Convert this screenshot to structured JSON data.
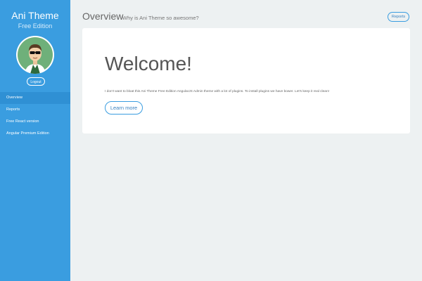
{
  "sidebar": {
    "brand_title": "Ani Theme",
    "brand_subtitle": "Free Edition",
    "avatar_icon": "user-avatar-icon",
    "logout_label": "Logout",
    "items": [
      {
        "label": "Overview",
        "active": true
      },
      {
        "label": "Reports",
        "active": false
      },
      {
        "label": "Free React version",
        "active": false
      },
      {
        "label": "Angular Premium Edition",
        "active": false
      }
    ]
  },
  "header": {
    "title": "Overview",
    "subtitle": "Why is Ani Theme so awesome?",
    "reports_label": "Reports"
  },
  "card": {
    "heading": "Welcome!",
    "description": "I don't want to bloat this Ani Theme Free Edition AngularJS Admin theme with a lot of plugins. To install plugins we have bower. Let's keep it real clean!",
    "button_label": "Learn more"
  },
  "colors": {
    "sidebar_bg": "#3a9de0",
    "sidebar_active": "#2f90d4",
    "page_bg": "#edf1f2",
    "accent": "#3a9de0"
  }
}
